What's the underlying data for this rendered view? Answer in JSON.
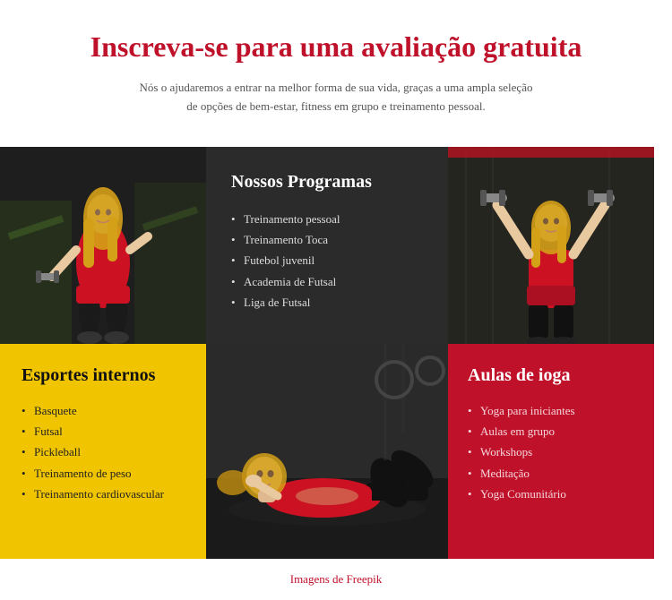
{
  "header": {
    "title": "Inscreva-se para uma avaliação gratuita",
    "subtitle": "Nós o ajudaremos a entrar na melhor forma de sua vida, graças a uma ampla seleção de opções de bem-estar, fitness em grupo e treinamento pessoal."
  },
  "programs_section": {
    "title": "Nossos Programas",
    "items": [
      "Treinamento pessoal",
      "Treinamento Toca",
      "Futebol juvenil",
      "Academia de Futsal",
      "Liga de Futsal"
    ]
  },
  "sports_section": {
    "title": "Esportes internos",
    "items": [
      "Basquete",
      "Futsal",
      "Pickleball",
      "Treinamento de peso",
      "Treinamento cardiovascular"
    ]
  },
  "yoga_section": {
    "title": "Aulas de ioga",
    "items": [
      "Yoga para iniciantes",
      "Aulas em grupo",
      "Workshops",
      "Meditação",
      "Yoga Comunitário"
    ]
  },
  "footer": {
    "link_text": "Imagens de Freepik"
  }
}
